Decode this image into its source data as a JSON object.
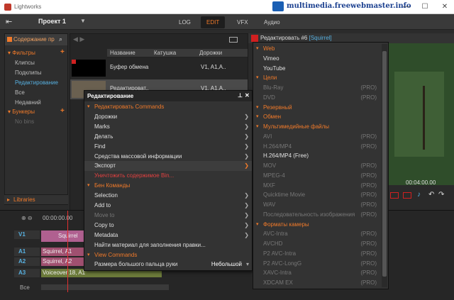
{
  "window": {
    "title": "Lightworks",
    "watermark": "multimedia.freewebmaster.info",
    "controls": [
      "—",
      "☐",
      "✕"
    ]
  },
  "menubar": {
    "project": "Проект 1",
    "tabs": [
      "LOG",
      "EDIT",
      "VFX",
      "Аудио"
    ],
    "active_tab": "EDIT"
  },
  "left_panel": {
    "header": "Содержание пр",
    "sections": [
      {
        "label": "Фильтры",
        "items": [
          "Клипсы",
          "Подклипы",
          "Редактирование",
          "Все",
          "Недавний"
        ],
        "selected": "Редактирование"
      },
      {
        "label": "Бункеры",
        "items": [
          "No bins"
        ]
      }
    ],
    "libraries": "Libraries"
  },
  "bin": {
    "columns": [
      "Название",
      "Катушка",
      "Дорожки"
    ],
    "rows": [
      {
        "name": "Буфер обмена",
        "reel": "",
        "tracks": "V1, A1,A.."
      },
      {
        "name": "Редактироват..",
        "reel": "",
        "tracks": "V1, A1,A.."
      }
    ]
  },
  "context_menu": {
    "title": "Редактирование",
    "items": [
      {
        "type": "section",
        "label": "Редактировать Commands"
      },
      {
        "label": "Дорожки",
        "submenu": true
      },
      {
        "label": "Marks",
        "submenu": true
      },
      {
        "label": "Делать",
        "submenu": true
      },
      {
        "label": "Find",
        "submenu": true
      },
      {
        "label": "Средства массовой информации",
        "submenu": true
      },
      {
        "label": "Экспорт",
        "submenu": true,
        "active": true
      },
      {
        "label": "Уничтожить содержимое Bin...",
        "danger": true
      },
      {
        "type": "section",
        "label": "Бен Команды"
      },
      {
        "label": "Selection",
        "submenu": true
      },
      {
        "label": "Add to",
        "submenu": true
      },
      {
        "label": "Move to",
        "submenu": true,
        "disabled": true
      },
      {
        "label": "Copy to",
        "submenu": true
      },
      {
        "label": "Metadata",
        "submenu": true
      },
      {
        "label": "Найти материал для заполнения правки..."
      },
      {
        "type": "section",
        "label": "View Commands"
      },
      {
        "label": "Размера большого пальца руки",
        "value": "Небольшой"
      }
    ]
  },
  "right_panel": {
    "title": "Редактировать #6",
    "tag": "[Squirrel]",
    "timecode": "00:04:00.00"
  },
  "export_submenu": {
    "items": [
      {
        "type": "section",
        "label": "Web"
      },
      {
        "label": "Vimeo"
      },
      {
        "label": "YouTube"
      },
      {
        "type": "section",
        "label": "Цели"
      },
      {
        "label": "Blu-Ray",
        "pro": "(PRO)"
      },
      {
        "label": "DVD",
        "pro": "(PRO)"
      },
      {
        "type": "section",
        "label": "Резервный"
      },
      {
        "type": "section",
        "label": "Обмен"
      },
      {
        "type": "section",
        "label": "Мультимедийные файлы"
      },
      {
        "label": "AVI",
        "pro": "(PRO)"
      },
      {
        "label": "H.264/MP4",
        "pro": "(PRO)"
      },
      {
        "label": "H.264/MP4 (Free)"
      },
      {
        "label": "MOV",
        "pro": "(PRO)"
      },
      {
        "label": "MPEG-4",
        "pro": "(PRO)"
      },
      {
        "label": "MXF",
        "pro": "(PRO)"
      },
      {
        "label": "Quicktime Movie",
        "pro": "(PRO)"
      },
      {
        "label": "WAV",
        "pro": "(PRO)"
      },
      {
        "label": "Последовательность изображения",
        "pro": "(PRO)"
      },
      {
        "type": "section",
        "label": "Форматы камеры"
      },
      {
        "label": "AVC-Intra",
        "pro": "(PRO)"
      },
      {
        "label": "AVCHD",
        "pro": "(PRO)"
      },
      {
        "label": "P2 AVC-Intra",
        "pro": "(PRO)"
      },
      {
        "label": "P2 AVC-LongG",
        "pro": "(PRO)"
      },
      {
        "label": "XAVC-Intra",
        "pro": "(PRO)"
      },
      {
        "label": "XDCAM EX",
        "pro": "(PRO)"
      }
    ]
  },
  "timeline": {
    "timecode": "00:00:00.00",
    "tracks": [
      "V1",
      "A1",
      "A2",
      "A3"
    ],
    "all_label": "Все",
    "clips": {
      "v1": "Squirrel",
      "a1": "Squirrel, A1",
      "a2": "Squirrel, A2",
      "a3": "Voiceover 18, A1"
    }
  },
  "colors": {
    "accent": "#f07a2a",
    "selected": "#57b0e0",
    "danger": "#e04040"
  }
}
